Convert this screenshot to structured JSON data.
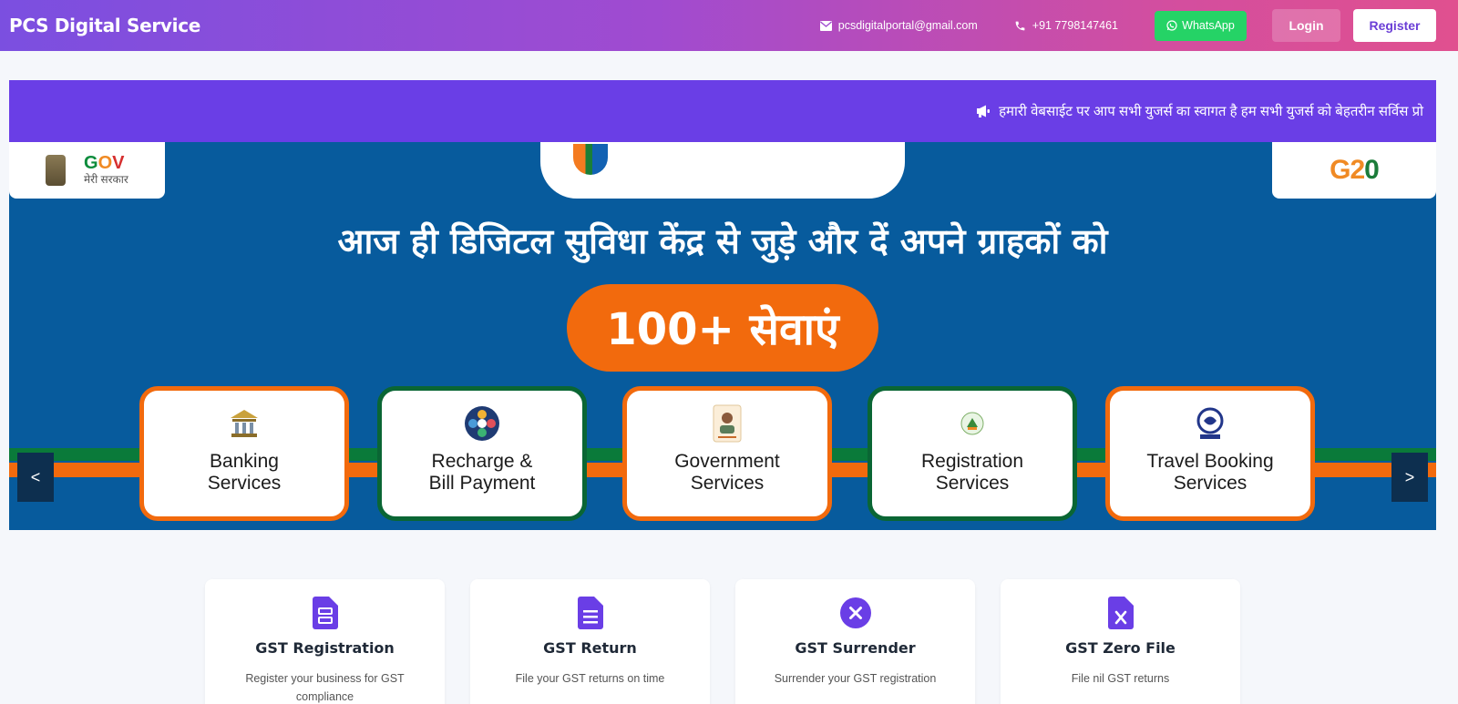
{
  "header": {
    "brand": "PCS Digital Service",
    "email": "pcsdigitalportal@gmail.com",
    "phone": "+91 7798147461",
    "whatsapp_label": "WhatsApp",
    "login_label": "Login",
    "register_label": "Register"
  },
  "marquee": {
    "icon": "bullhorn-icon",
    "text": "हमारी वेबसाईट पर आप सभी युजर्स का स्वागत है हम सभी युजर्स को बेहतरीन सर्विस प्रो"
  },
  "banner": {
    "left_logo": {
      "title": "GOV",
      "subtitle": "मेरी सरकार"
    },
    "right_logo": {
      "title": "G20"
    },
    "headline": "आज ही डिजिटल सुविधा केंद्र से जुड़े और दें अपने ग्राहकों को",
    "badge": "100+ सेवाएं",
    "prev_label": "<",
    "next_label": ">",
    "services": [
      {
        "label": "Banking\nServices",
        "icon": "bank-icon"
      },
      {
        "label": "Recharge &\nBill Payment",
        "icon": "bill-payment-icon"
      },
      {
        "label": "Government\nServices",
        "icon": "id-card-icon"
      },
      {
        "label": "Registration\nServices",
        "icon": "registration-icon"
      },
      {
        "label": "Travel Booking\nServices",
        "icon": "irctc-icon"
      }
    ]
  },
  "cards": [
    {
      "title": "GST Registration",
      "desc": "Register your business for GST compliance",
      "icon": "document-form-icon"
    },
    {
      "title": "GST Return",
      "desc": "File your GST returns on time",
      "icon": "document-lines-icon"
    },
    {
      "title": "GST Surrender",
      "desc": "Surrender your GST registration",
      "icon": "close-circle-icon"
    },
    {
      "title": "GST Zero File",
      "desc": "File nil GST returns",
      "icon": "document-x-icon"
    }
  ],
  "colors": {
    "accent": "#6a3ee6",
    "banner_blue": "#075b9d",
    "saffron": "#f26a0d",
    "india_green": "#0a7a3a",
    "whatsapp": "#25d366"
  }
}
